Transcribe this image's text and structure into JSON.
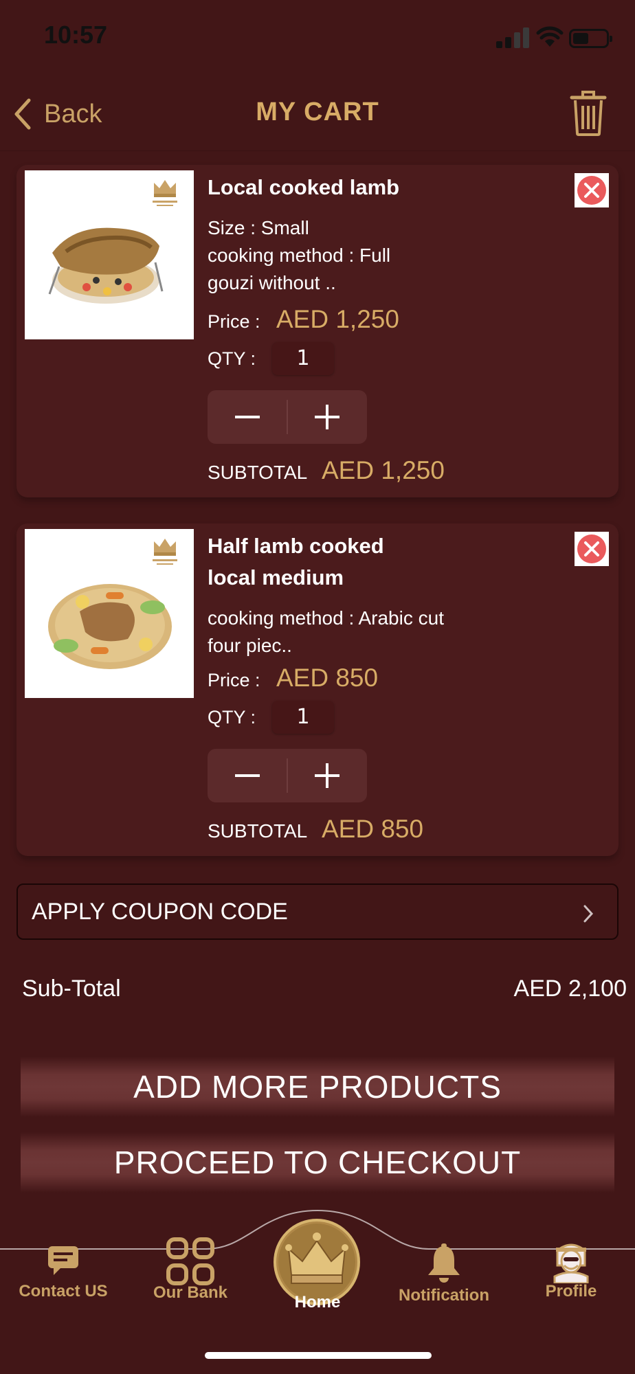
{
  "status": {
    "time": "10:57"
  },
  "header": {
    "back_label": "Back",
    "title": "MY CART"
  },
  "cart_items": [
    {
      "name": "Local cooked lamb",
      "details": [
        "Size : Small",
        "cooking method :  Full",
        "gouzi without .."
      ],
      "price_label": "Price :",
      "price": "AED 1,250",
      "qty_label": "QTY :",
      "qty": "1",
      "subtotal_label": "SUBTOTAL",
      "subtotal": "AED 1,250"
    },
    {
      "name_lines": [
        "Half lamb cooked",
        "local medium"
      ],
      "details": [
        "cooking method : Arabic cut",
        "four piec.."
      ],
      "price_label": "Price :",
      "price": "AED 850",
      "qty_label": "QTY :",
      "qty": "1",
      "subtotal_label": "SUBTOTAL",
      "subtotal": "AED 850"
    }
  ],
  "coupon": {
    "label": "APPLY COUPON CODE"
  },
  "summary": {
    "label": "Sub-Total",
    "value": "AED 2,100"
  },
  "buttons": {
    "add_more": "ADD MORE PRODUCTS",
    "checkout": "PROCEED TO CHECKOUT"
  },
  "nav": {
    "contact": "Contact US",
    "bank": "Our Bank",
    "home": "Home",
    "notification": "Notification",
    "profile": "Profile"
  },
  "colors": {
    "background": "#421617",
    "card": "#4b1b1c",
    "gold": "#d8ac66",
    "remove": "#ea5a5c"
  }
}
